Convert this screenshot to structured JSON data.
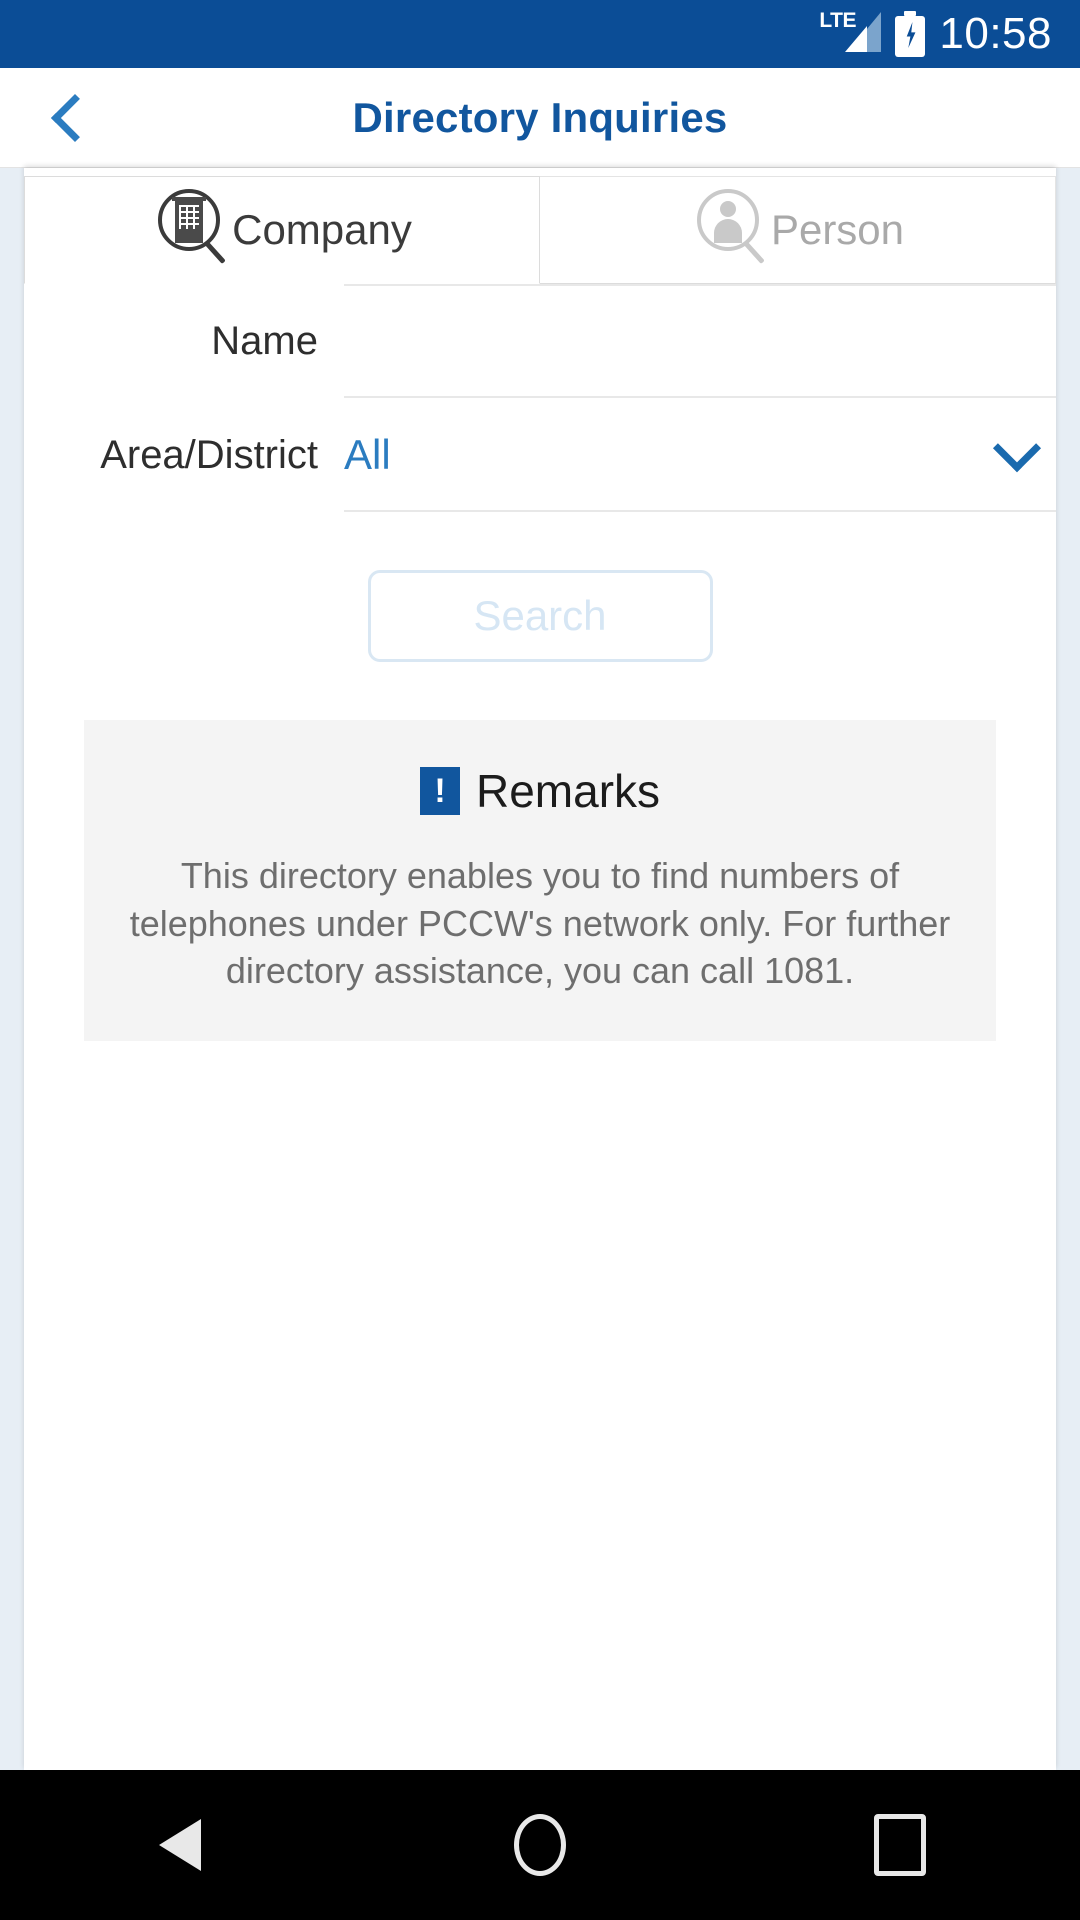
{
  "status_bar": {
    "network_label": "LTE",
    "time": "10:58",
    "battery_state": "charging"
  },
  "header": {
    "title": "Directory Inquiries",
    "back_label": "Back"
  },
  "tabs": [
    {
      "label": "Company",
      "icon": "building-search-icon",
      "active": true
    },
    {
      "label": "Person",
      "icon": "person-search-icon",
      "active": false
    }
  ],
  "form": {
    "name": {
      "label": "Name",
      "value": "",
      "placeholder": ""
    },
    "area_district": {
      "label": "Area/District",
      "value": "All",
      "chevron": "chevron-down-icon"
    }
  },
  "search_button": {
    "label": "Search",
    "enabled": false
  },
  "remarks": {
    "icon": "exclamation-icon",
    "icon_glyph": "!",
    "title": "Remarks",
    "text": "This directory enables you to find numbers of telephones under PCCW's network only. For further directory assistance, you can call 1081."
  },
  "nav_bar": {
    "back": "back-triangle-icon",
    "home": "home-circle-icon",
    "recents": "recents-square-icon"
  },
  "colors": {
    "status_bar_bg": "#0b4d96",
    "header_title": "#11569e",
    "accent_blue": "#2b7cc0",
    "page_bg": "#e7eef5",
    "remarks_bg": "#f4f4f4"
  }
}
